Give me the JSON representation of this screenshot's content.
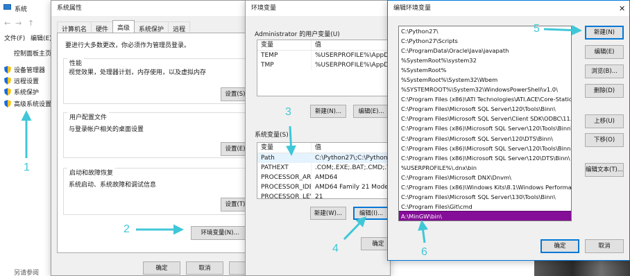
{
  "system_window": {
    "title": "系统",
    "menu": [
      "文件(F)",
      "编辑(E)"
    ],
    "home_link": "控制面板主页",
    "sidebar": [
      "设备管理器",
      "远程设置",
      "系统保护",
      "高级系统设置"
    ],
    "see_also": "另请参阅"
  },
  "sysprops": {
    "title": "系统属性",
    "tabs": [
      "计算机名",
      "硬件",
      "高级",
      "系统保护",
      "远程"
    ],
    "admin_note": "要进行大多数更改，你必须作为管理员登录。",
    "perf": {
      "title": "性能",
      "desc": "视觉效果，处理器计划，内存使用，以及虚拟内存",
      "btn": "设置(S)..."
    },
    "profile": {
      "title": "用户配置文件",
      "desc": "与登录帐户相关的桌面设置",
      "btn": "设置(E)..."
    },
    "startup": {
      "title": "启动和故障恢复",
      "desc": "系统启动、系统故障和调试信息",
      "btn": "设置(T)..."
    },
    "env_btn": "环境变量(N)...",
    "ok": "确定",
    "cancel": "取消",
    "apply": "应"
  },
  "envvars": {
    "title": "环境变量",
    "user_label": "Administrator 的用户变量(U)",
    "col_var": "变量",
    "col_val": "值",
    "user_rows": [
      {
        "name": "TEMP",
        "value": "%USERPROFILE%\\AppData"
      },
      {
        "name": "TMP",
        "value": "%USERPROFILE%\\AppData"
      }
    ],
    "user_new": "新建(N)...",
    "user_edit": "编辑(E)...",
    "sys_label": "系统变量(S)",
    "sys_rows": [
      {
        "name": "Path",
        "value": "C:\\Python27\\;C:\\Python27\\"
      },
      {
        "name": "PATHEXT",
        "value": ".COM;.EXE;.BAT;.CMD;.VBS;"
      },
      {
        "name": "PROCESSOR_AR...",
        "value": "AMD64"
      },
      {
        "name": "PROCESSOR_IDE...",
        "value": "AMD64 Family 21 Model 16"
      },
      {
        "name": "PROCESSOR_LEV...",
        "value": "21"
      }
    ],
    "sys_new": "新建(W)...",
    "sys_edit": "编辑(I)...",
    "ok": "确定"
  },
  "editenv": {
    "title": "编辑环境变量",
    "close": "✕",
    "paths": [
      "C:\\Python27\\",
      "C:\\Python27\\Scripts",
      "C:\\ProgramData\\Oracle\\Java\\javapath",
      "%SystemRoot%\\system32",
      "%SystemRoot%",
      "%SystemRoot%\\System32\\Wbem",
      "%SYSTEMROOT%\\System32\\WindowsPowerShell\\v1.0\\",
      "C:\\Program Files (x86)\\ATI Technologies\\ATI.ACE\\Core-Static",
      "C:\\Program Files\\Microsoft SQL Server\\120\\Tools\\Binn\\",
      "C:\\Program Files\\Microsoft SQL Server\\Client SDK\\ODBC\\11...",
      "C:\\Program Files (x86)\\Microsoft SQL Server\\120\\Tools\\Binn\\",
      "C:\\Program Files\\Microsoft SQL Server\\120\\DTS\\Binn\\",
      "C:\\Program Files (x86)\\Microsoft SQL Server\\120\\Tools\\Binn...",
      "C:\\Program Files (x86)\\Microsoft SQL Server\\120\\DTS\\Binn\\",
      "%USERPROFILE%\\.dnx\\bin",
      "C:\\Program Files\\Microsoft DNX\\Dnvm\\",
      "C:\\Program Files (x86)\\Windows Kits\\8.1\\Windows Performa...",
      "C:\\Program Files\\Microsoft SQL Server\\130\\Tools\\Binn\\",
      "C:\\Program Files\\Git\\cmd",
      "A:\\MinGW\\bin\\"
    ],
    "selected_index": 19,
    "btn_new": "新建(N)",
    "btn_edit": "编辑(E)",
    "btn_browse": "浏览(B)...",
    "btn_delete": "删除(D)",
    "btn_up": "上移(U)",
    "btn_down": "下移(O)",
    "btn_edit_text": "编辑文本(T)...",
    "ok": "确定",
    "cancel": "取消"
  },
  "annotations": [
    "1",
    "2",
    "3",
    "4",
    "5",
    "6"
  ],
  "colors": {
    "annotation": "#3fc7d8",
    "selection": "#850e98",
    "accent": "#0078d7"
  }
}
